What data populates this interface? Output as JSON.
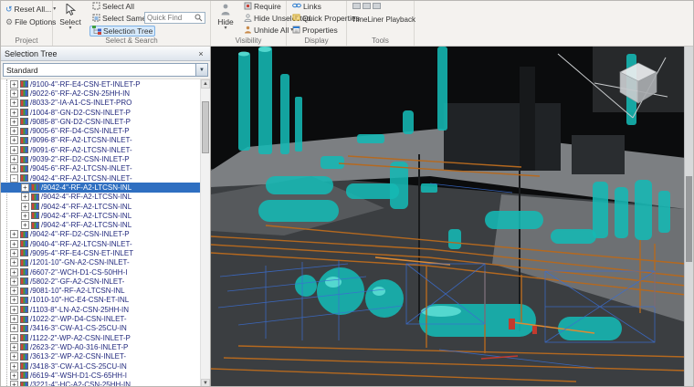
{
  "ribbon": {
    "project": {
      "label": "Project",
      "reset_all": "Reset All...",
      "file_options": "File Options"
    },
    "select_search": {
      "label": "Select & Search",
      "select": "Select",
      "select_all": "Select All",
      "select_same": "Select Same",
      "quick_find_placeholder": "Quick Find",
      "selection_tree": "Selection Tree"
    },
    "visibility": {
      "label": "Visibility",
      "hide": "Hide",
      "require": "Require",
      "hide_unselected": "Hide Unselected",
      "unhide_all": "Unhide All"
    },
    "display": {
      "label": "Display",
      "links": "Links",
      "quick_properties": "Quick Properties",
      "properties": "Properties"
    },
    "tools": {
      "label": "Tools",
      "timeliner_playback": "TimeLiner Playback"
    }
  },
  "selection_tree_panel": {
    "title": "Selection Tree",
    "close_glyph": "×",
    "mode_selected": "Standard",
    "selection_color": "#2f6fc1",
    "items": [
      {
        "label": "/9100-4\"-RF-E4-CSN-ET-INLET-P",
        "level": 1,
        "expanded": false,
        "selected": false
      },
      {
        "label": "/9022-6\"-RF-A2-CSN-25HH-IN",
        "level": 1,
        "expanded": false,
        "selected": false
      },
      {
        "label": "/8033-2\"-IA-A1-CS-INLET-PRO",
        "level": 1,
        "expanded": false,
        "selected": false
      },
      {
        "label": "/1004-8\"-GN-D2-CSN-INLET-P",
        "level": 1,
        "expanded": false,
        "selected": false
      },
      {
        "label": "/9085-8\"-GN-D2-CSN-INLET-P",
        "level": 1,
        "expanded": false,
        "selected": false
      },
      {
        "label": "/9005-6\"-RF-D4-CSN-INLET-P",
        "level": 1,
        "expanded": false,
        "selected": false
      },
      {
        "label": "/9096-8\"-RF-A2-LTCSN-INLET-",
        "level": 1,
        "expanded": false,
        "selected": false
      },
      {
        "label": "/9091-6\"-RF-A2-LTCSN-INLET-",
        "level": 1,
        "expanded": false,
        "selected": false
      },
      {
        "label": "/9039-2\"-RF-D2-CSN-INLET-P",
        "level": 1,
        "expanded": false,
        "selected": false
      },
      {
        "label": "/9045-6\"-RF-A2-LTCSN-INLET-",
        "level": 1,
        "expanded": false,
        "selected": false
      },
      {
        "label": "/9042-4\"-RF-A2-LTCSN-INLET-",
        "level": 1,
        "expanded": true,
        "selected": false
      },
      {
        "label": "/9042-4\"-RF-A2-LTCSN-INL",
        "level": 2,
        "expanded": false,
        "selected": true
      },
      {
        "label": "/9042-4\"-RF-A2-LTCSN-INL",
        "level": 2,
        "expanded": false,
        "selected": false
      },
      {
        "label": "/9042-4\"-RF-A2-LTCSN-INL",
        "level": 2,
        "expanded": false,
        "selected": false
      },
      {
        "label": "/9042-4\"-RF-A2-LTCSN-INL",
        "level": 2,
        "expanded": false,
        "selected": false
      },
      {
        "label": "/9042-4\"-RF-A2-LTCSN-INL",
        "level": 2,
        "expanded": false,
        "selected": false
      },
      {
        "label": "/9042-4\"-RF-D2-CSN-INLET-P",
        "level": 1,
        "expanded": false,
        "selected": false
      },
      {
        "label": "/9040-4\"-RF-A2-LTCSN-INLET-",
        "level": 1,
        "expanded": false,
        "selected": false
      },
      {
        "label": "/9095-4\"-RF-E4-CSN-ET-INLET",
        "level": 1,
        "expanded": false,
        "selected": false
      },
      {
        "label": "/1201-10\"-GN-A2-CSN-INLET-",
        "level": 1,
        "expanded": false,
        "selected": false
      },
      {
        "label": "/6607-2\"-WCH-D1-CS-50HH-I",
        "level": 1,
        "expanded": false,
        "selected": false
      },
      {
        "label": "/5802-2\"-GF-A2-CSN-INLET-",
        "level": 1,
        "expanded": false,
        "selected": false
      },
      {
        "label": "/9081-10\"-RF-A2-LTCSN-INL",
        "level": 1,
        "expanded": false,
        "selected": false
      },
      {
        "label": "/1010-10\"-HC-E4-CSN-ET-INL",
        "level": 1,
        "expanded": false,
        "selected": false
      },
      {
        "label": "/1103-8\"-LN-A2-CSN-25HH-IN",
        "level": 1,
        "expanded": false,
        "selected": false
      },
      {
        "label": "/1022-2\"-WP-D4-CSN-INLET-",
        "level": 1,
        "expanded": false,
        "selected": false
      },
      {
        "label": "/3416-3\"-CW-A1-CS-25CU-IN",
        "level": 1,
        "expanded": false,
        "selected": false
      },
      {
        "label": "/1122-2\"-WP-A2-CSN-INLET-P",
        "level": 1,
        "expanded": false,
        "selected": false
      },
      {
        "label": "/2623-2\"-WD-A0-316-INLET-P",
        "level": 1,
        "expanded": false,
        "selected": false
      },
      {
        "label": "/3613-2\"-WP-A2-CSN-INLET-",
        "level": 1,
        "expanded": false,
        "selected": false
      },
      {
        "label": "/3418-3\"-CW-A1-CS-25CU-IN",
        "level": 1,
        "expanded": false,
        "selected": false
      },
      {
        "label": "/6619-4\"-WSH-D1-CS-65HH-I",
        "level": 1,
        "expanded": false,
        "selected": false
      },
      {
        "label": "/3221-4\"-HC-A2-CSN-25HH-IN",
        "level": 1,
        "expanded": false,
        "selected": false
      }
    ]
  },
  "viewport": {
    "colors": {
      "background": "#0b0c0d",
      "ground": "#7c7f82",
      "equipment": "#14b8b4",
      "equipment_highlight": "#63e3da",
      "pipes": "#b5691f",
      "wireframe": "#3b6ed2"
    }
  }
}
